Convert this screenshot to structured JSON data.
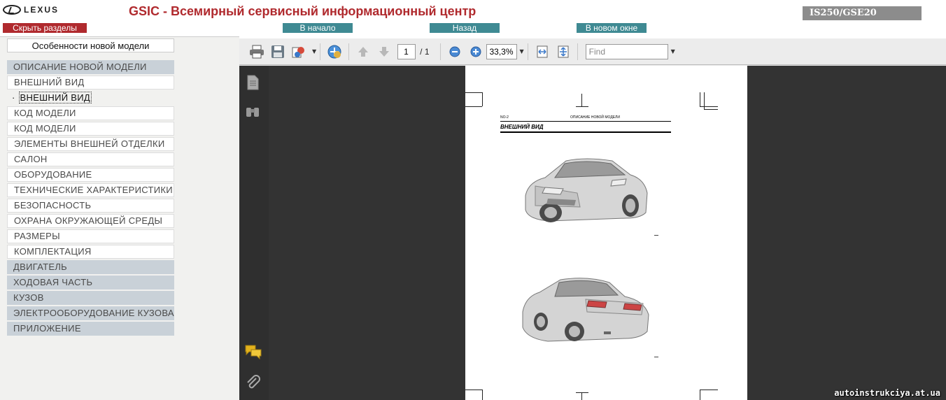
{
  "header": {
    "logo_text": "LEXUS",
    "title": "GSIC - Всемирный сервисный информационный центр",
    "model": "IS250/GSE20",
    "hide_sections": "Скрыть разделы",
    "home": "В начало",
    "back": "Назад",
    "new_window": "В новом окне"
  },
  "sidebar": {
    "section_title": "Особенности новой модели",
    "items": [
      {
        "label": "ОПИСАНИЕ НОВОЙ МОДЕЛИ",
        "kind": "cat"
      },
      {
        "label": "ВНЕШНИЙ ВИД",
        "kind": "sub"
      },
      {
        "label": "ВНЕШНИЙ ВИД",
        "kind": "active"
      },
      {
        "label": "КОД МОДЕЛИ",
        "kind": "sub"
      },
      {
        "label": "КОД МОДЕЛИ",
        "kind": "sub"
      },
      {
        "label": "ЭЛЕМЕНТЫ ВНЕШНЕЙ ОТДЕЛКИ",
        "kind": "sub"
      },
      {
        "label": "САЛОН",
        "kind": "sub"
      },
      {
        "label": "ОБОРУДОВАНИЕ",
        "kind": "sub"
      },
      {
        "label": "ТЕХНИЧЕСКИЕ ХАРАКТЕРИСТИКИ",
        "kind": "sub"
      },
      {
        "label": "БЕЗОПАСНОСТЬ",
        "kind": "sub"
      },
      {
        "label": "ОХРАНА ОКРУЖАЮЩЕЙ СРЕДЫ",
        "kind": "sub"
      },
      {
        "label": "РАЗМЕРЫ",
        "kind": "sub"
      },
      {
        "label": "КОМПЛЕКТАЦИЯ",
        "kind": "sub"
      },
      {
        "label": "ДВИГАТЕЛЬ",
        "kind": "cat"
      },
      {
        "label": "ХОДОВАЯ ЧАСТЬ",
        "kind": "cat"
      },
      {
        "label": "КУЗОВ",
        "kind": "cat"
      },
      {
        "label": "ЭЛЕКТРООБОРУДОВАНИЕ КУЗОВА",
        "kind": "cat"
      },
      {
        "label": "ПРИЛОЖЕНИЕ",
        "kind": "cat"
      }
    ]
  },
  "viewer": {
    "page_current": "1",
    "page_total": "/ 1",
    "zoom": "33,3%",
    "find_placeholder": "Find"
  },
  "document": {
    "page_code": "NO-2",
    "section": "ОПИСАНИЕ НОВОЙ МОДЕЛИ",
    "heading": "ВНЕШНИЙ ВИД"
  },
  "watermark": "autoinstrukciya.at.ua"
}
